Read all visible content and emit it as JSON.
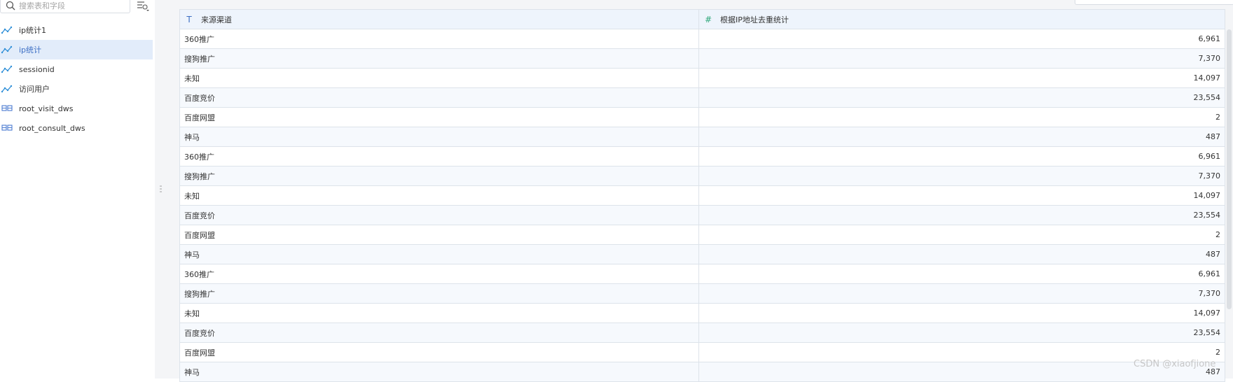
{
  "sidebar": {
    "search_placeholder": "搜索表和字段",
    "items": [
      {
        "label": "ip统计1",
        "icon": "metric-icon",
        "active": false
      },
      {
        "label": "ip统计",
        "icon": "metric-icon",
        "active": true
      },
      {
        "label": "sessionid",
        "icon": "metric-icon",
        "active": false
      },
      {
        "label": "访问用户",
        "icon": "metric-icon",
        "active": false
      },
      {
        "label": "root_visit_dws",
        "icon": "table-icon",
        "active": false
      },
      {
        "label": "root_consult_dws",
        "icon": "table-icon",
        "active": false
      }
    ]
  },
  "table": {
    "columns": [
      {
        "label": "来源渠道",
        "icon": "text-field-icon"
      },
      {
        "label": "根据IP地址去重统计",
        "icon": "number-field-icon"
      }
    ],
    "rows": [
      [
        "360推广",
        "6,961"
      ],
      [
        "搜狗推广",
        "7,370"
      ],
      [
        "未知",
        "14,097"
      ],
      [
        "百度竞价",
        "23,554"
      ],
      [
        "百度网盟",
        "2"
      ],
      [
        "神马",
        "487"
      ],
      [
        "360推广",
        "6,961"
      ],
      [
        "搜狗推广",
        "7,370"
      ],
      [
        "未知",
        "14,097"
      ],
      [
        "百度竞价",
        "23,554"
      ],
      [
        "百度网盟",
        "2"
      ],
      [
        "神马",
        "487"
      ],
      [
        "360推广",
        "6,961"
      ],
      [
        "搜狗推广",
        "7,370"
      ],
      [
        "未知",
        "14,097"
      ],
      [
        "百度竞价",
        "23,554"
      ],
      [
        "百度网盟",
        "2"
      ],
      [
        "神马",
        "487"
      ]
    ]
  },
  "watermark": "CSDN @xiaofjione",
  "colors": {
    "accent": "#3d6fc4",
    "active_bg": "#e2ecfa",
    "header_bg": "#eef4fc",
    "metric_icon": "#2f8fd8",
    "table_icon": "#4a7bd0"
  }
}
